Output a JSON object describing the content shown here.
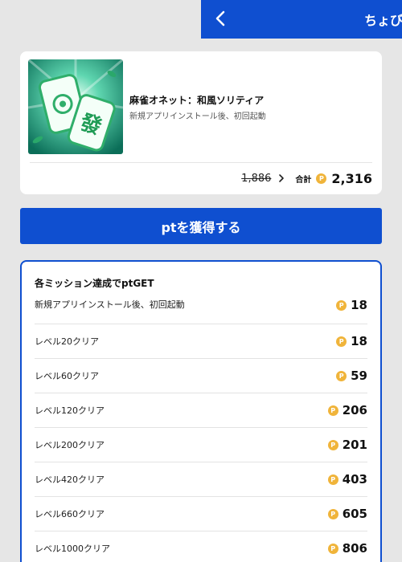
{
  "header": {
    "title": "ちょび",
    "back_icon": "chevron-left-icon"
  },
  "app": {
    "title": "麻雀オネット：和風ソリティア",
    "condition": "新規アプリインストール後、初回起動",
    "old_points": "1,886",
    "total_label": "合計",
    "total_points": "2,316",
    "coin_glyph": "P",
    "image_glyph": "發"
  },
  "cta": {
    "label": "ptを獲得する"
  },
  "missions": {
    "heading": "各ミッション達成でptGET",
    "items": [
      {
        "label": "新規アプリインストール後、初回起動",
        "points": "18"
      },
      {
        "label": "レベル20クリア",
        "points": "18"
      },
      {
        "label": "レベル60クリア",
        "points": "59"
      },
      {
        "label": "レベル120クリア",
        "points": "206"
      },
      {
        "label": "レベル200クリア",
        "points": "201"
      },
      {
        "label": "レベル420クリア",
        "points": "403"
      },
      {
        "label": "レベル660クリア",
        "points": "605"
      },
      {
        "label": "レベル1000クリア",
        "points": "806"
      }
    ]
  },
  "colors": {
    "primary": "#0f4fd0",
    "coin": "#f0b43a",
    "background": "#e6e6e6"
  }
}
